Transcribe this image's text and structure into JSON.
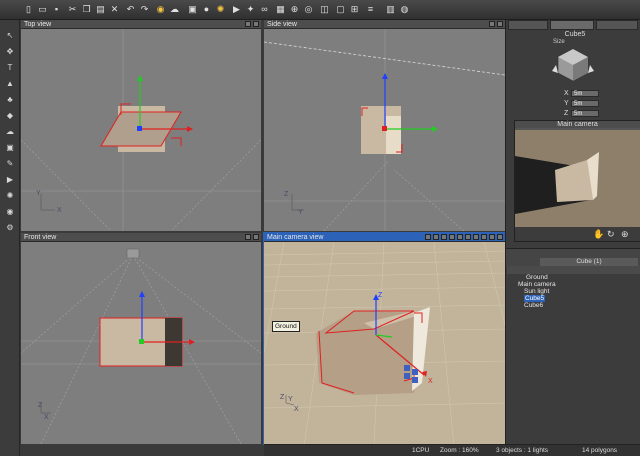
{
  "viewports": {
    "top": {
      "title": "Top view"
    },
    "side": {
      "title": "Side view"
    },
    "front": {
      "title": "Front view"
    },
    "camera": {
      "title": "Main camera view",
      "tooltip": "Ground",
      "axis_x": "X",
      "axis_z": "Z"
    }
  },
  "axes": {
    "x": "X",
    "y": "Y",
    "z": "Z"
  },
  "right_panel": {
    "object_name": "Cube5",
    "size_label": "Size",
    "fields": [
      {
        "label": "X",
        "value": "5m"
      },
      {
        "label": "Y",
        "value": "5m"
      },
      {
        "label": "Z",
        "value": "5m"
      }
    ],
    "camera_preview_title": "Main camera",
    "list_header": "Cube (1)"
  },
  "scene_tree": [
    {
      "label": "Ground",
      "selected": false
    },
    {
      "label": "Main camera",
      "selected": false
    },
    {
      "label": "Sun light",
      "selected": false
    },
    {
      "label": "Cube5",
      "selected": true
    },
    {
      "label": "Cube6",
      "selected": false
    }
  ],
  "status": {
    "cpu": "1CPU",
    "zoom": "Zoom : 160%",
    "objects": "3 objects : 1 lights",
    "polygons": "14 polygons"
  },
  "colors": {
    "viewport_bg": "#7e7e7e",
    "camera_floor": "#c2b49b",
    "cube_face": "#c9b9a2",
    "selection_red": "#e02020",
    "axis_green": "#22cc22",
    "axis_blue": "#2040ff",
    "active_header": "#2c63b8"
  },
  "icons": {
    "toolbar": [
      "new-file-icon",
      "open-file-icon",
      "save-icon",
      "cut-icon",
      "copy-icon",
      "paste-icon",
      "delete-icon",
      "undo-icon",
      "redo-icon",
      "render-icon",
      "cloud-icon",
      "cube-icon",
      "sphere-icon",
      "light-icon",
      "camera-icon",
      "wand-icon",
      "link-icon",
      "grid-icon",
      "zoom-icon",
      "target-icon",
      "view-icon",
      "frame-icon",
      "snap-icon",
      "align-icon",
      "display-icon",
      "globe-icon"
    ],
    "left_tools": [
      "select-icon",
      "move-icon",
      "text-icon",
      "terrain-icon",
      "plant-icon",
      "rock-icon",
      "cloud-icon",
      "cube-icon",
      "paint-icon",
      "camera-icon",
      "light-icon",
      "render-icon",
      "settings-icon"
    ]
  }
}
